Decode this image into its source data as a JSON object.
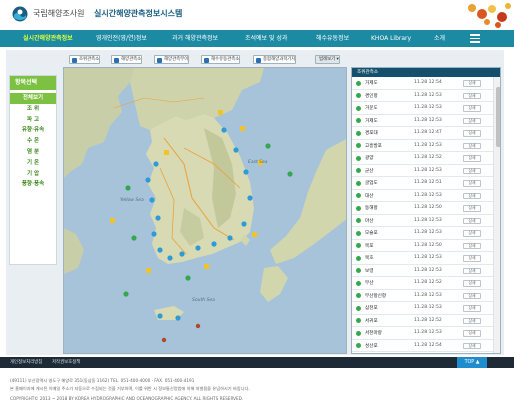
{
  "header": {
    "org_name": "국립해양조사원",
    "system_name": "실시간해양관측정보시스템"
  },
  "nav": {
    "items": [
      {
        "label": "실시간해양관측정보",
        "active": true
      },
      {
        "label": "영개인전(영/연)정보",
        "active": false
      },
      {
        "label": "과거 해양관측정보",
        "active": false
      },
      {
        "label": "조석예보 및 성과",
        "active": false
      },
      {
        "label": "해수유동정보",
        "active": false
      },
      {
        "label": "KHOA Library",
        "active": false
      },
      {
        "label": "소개",
        "active": false
      }
    ],
    "menu_icon": "hamburger-icon"
  },
  "layer_buttons": [
    {
      "label": "조위관측소"
    },
    {
      "label": "해양관측소"
    },
    {
      "label": "해양관측부이"
    },
    {
      "label": "해수유동관측소"
    },
    {
      "label": "종합해양과학기지"
    }
  ],
  "map_toggle": "범례보기 ▾",
  "sidebar": {
    "title": "항목선택",
    "items": [
      {
        "label": "전체보기",
        "active": true
      },
      {
        "label": "조 위",
        "active": false
      },
      {
        "label": "파 고",
        "active": false
      },
      {
        "label": "유향·유속",
        "active": false
      },
      {
        "label": "수 온",
        "active": false
      },
      {
        "label": "염 분",
        "active": false
      },
      {
        "label": "기 온",
        "active": false
      },
      {
        "label": "기 압",
        "active": false
      },
      {
        "label": "풍향·풍속",
        "active": false
      }
    ]
  },
  "map": {
    "labels": [
      "East Sea",
      "Yellow Sea",
      "South Sea"
    ]
  },
  "station_table": {
    "header_name": "조위관측소",
    "rows": [
      {
        "name": "거제도",
        "time": "11.28 12:54",
        "badge": "상세"
      },
      {
        "name": "경인항",
        "time": "11.28 12:53",
        "badge": "상세"
      },
      {
        "name": "거문도",
        "time": "11.28 12:53",
        "badge": "상세"
      },
      {
        "name": "거제도",
        "time": "11.28 12:53",
        "badge": "상세"
      },
      {
        "name": "경포대",
        "time": "11.28 12:47",
        "badge": "상세"
      },
      {
        "name": "고흥발포",
        "time": "11.28 12:53",
        "badge": "상세"
      },
      {
        "name": "광양",
        "time": "11.28 12:52",
        "badge": "상세"
      },
      {
        "name": "군산",
        "time": "11.28 12:53",
        "badge": "상세"
      },
      {
        "name": "굴업도",
        "time": "11.28 12:51",
        "badge": "상세"
      },
      {
        "name": "대산",
        "time": "11.28 12:53",
        "badge": "상세"
      },
      {
        "name": "동해항",
        "time": "11.28 12:50",
        "badge": "상세"
      },
      {
        "name": "마산",
        "time": "11.28 12:53",
        "badge": "상세"
      },
      {
        "name": "모슬포",
        "time": "11.28 12:53",
        "badge": "상세"
      },
      {
        "name": "목포",
        "time": "11.28 12:50",
        "badge": "상세"
      },
      {
        "name": "묵호",
        "time": "11.28 12:53",
        "badge": "상세"
      },
      {
        "name": "보령",
        "time": "11.28 12:53",
        "badge": "상세"
      },
      {
        "name": "부산",
        "time": "11.28 12:52",
        "badge": "상세"
      },
      {
        "name": "부산항신항",
        "time": "11.28 12:53",
        "badge": "상세"
      },
      {
        "name": "삼천포",
        "time": "11.28 12:53",
        "badge": "상세"
      },
      {
        "name": "서귀포",
        "time": "11.28 12:52",
        "badge": "상세"
      },
      {
        "name": "서천마량",
        "time": "11.28 12:53",
        "badge": "상세"
      },
      {
        "name": "성산포",
        "time": "11.28 12:54",
        "badge": "상세"
      },
      {
        "name": "속초",
        "time": "11.28 12:53",
        "badge": "상세"
      },
      {
        "name": "안산",
        "time": "11.28 12:53",
        "badge": "상세"
      },
      {
        "name": "안흥",
        "time": "11.28 12:53",
        "badge": "상세"
      },
      {
        "name": "어청도",
        "time": "11.28 12:53",
        "badge": "상세"
      }
    ]
  },
  "footer": {
    "links": [
      "개인정보처리방침",
      "저작권보호정책"
    ],
    "top_label": "TOP ▲",
    "address": "(49111) 부산광역시 영도구 해양로 351(동삼동 1162)   TEL. 051-400-4000 · FAX. 051-400-4191",
    "notice": "본 홈페이지에 게시된 이메일 주소가 자동으로 수집되는 것을 거부하며, 이를 위반 시 정보통신망법에 의해 처벌됨을 유념하시기 바랍니다.",
    "copyright": "COPYRIGHT© 2013 ~ 2018 BY KOREA HYDROGRAPHIC AND OCEANOGRAPHIC AGENCY. ALL RIGHTS RESERVED."
  }
}
